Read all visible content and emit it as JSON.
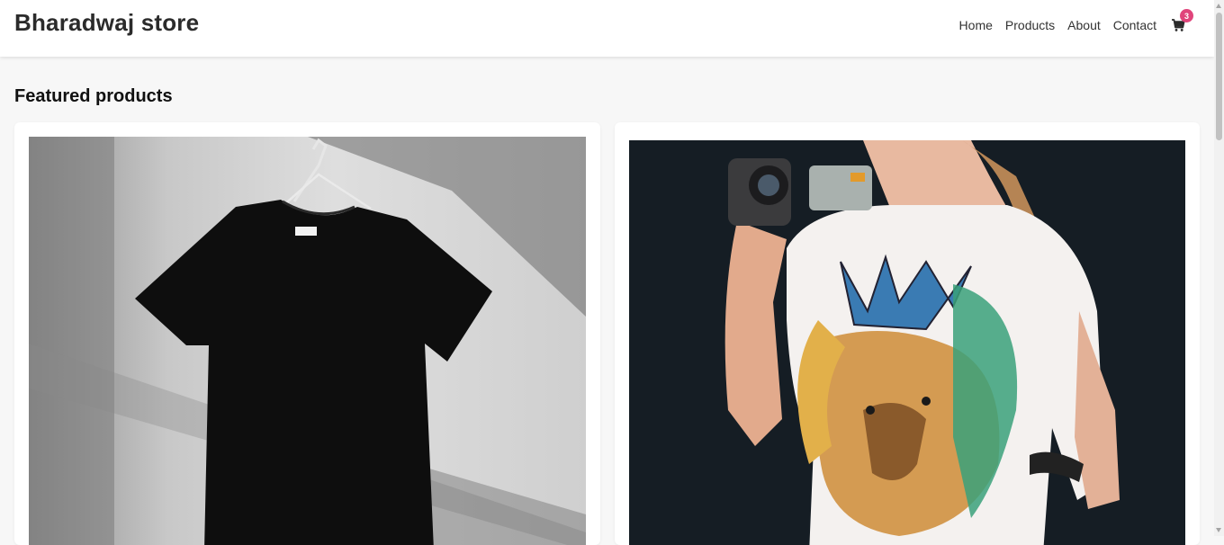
{
  "header": {
    "brand": "Bharadwaj store",
    "nav": [
      "Home",
      "Products",
      "About",
      "Contact"
    ],
    "cart_icon": "shopping-cart-icon",
    "cart_count": "3"
  },
  "main": {
    "section_title": "Featured products",
    "products": [
      {
        "image": "black t-shirt on hanger",
        "image_icon": "product-photo"
      },
      {
        "image": "woman wearing lion print t-shirt holding camcorder",
        "image_icon": "product-photo"
      }
    ]
  },
  "colors": {
    "badge": "#e0447b",
    "background": "#f7f7f7",
    "header": "#ffffff"
  }
}
